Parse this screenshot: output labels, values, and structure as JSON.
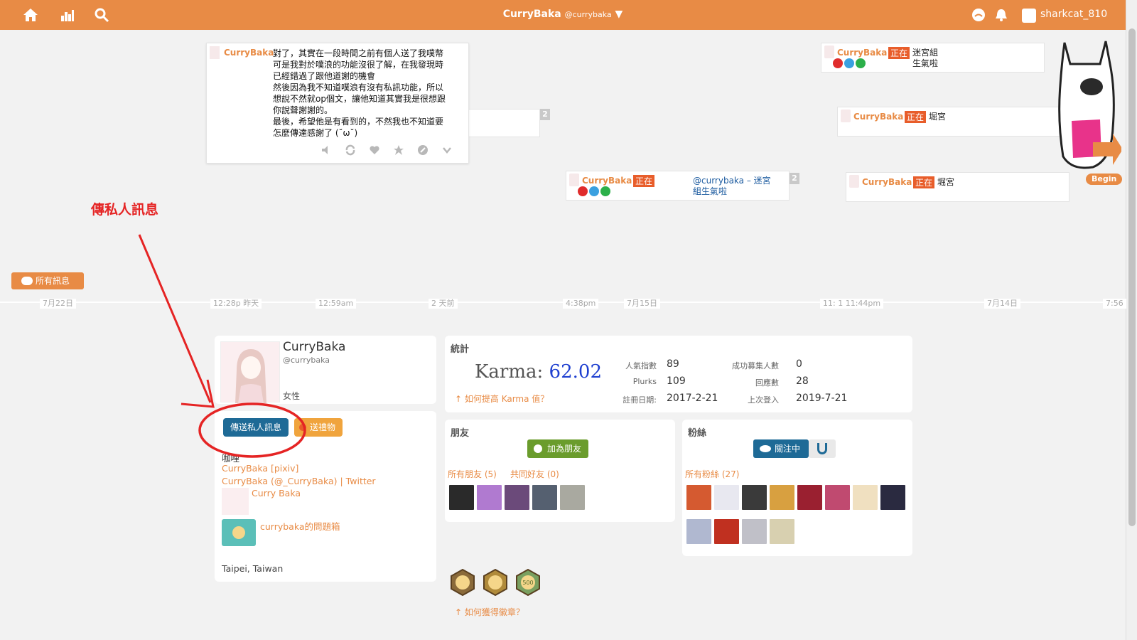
{
  "topbar": {
    "display_name": "CurryBaka",
    "handle": "@currybaka",
    "username": "sharkcat_810"
  },
  "colors": {
    "brand": "#e88b45",
    "link": "#e88b45",
    "karma": "#1e3fd0",
    "qualifier": "#e85d2a",
    "annotation": "#e52424"
  },
  "expanded_plurk": {
    "nick": "CurryBaka",
    "lines": [
      "對了，其實在一段時間之前有個人送了我噗幣",
      "可是我對於噗浪的功能沒很了解，在我發現時",
      "已經錯過了跟他道謝的機會",
      "然後因為我不知道噗浪有沒有私訊功能，所以",
      "想說不然就op個文，讓他知道其實我是很想跟",
      "你說聲謝謝的。",
      "最後，希望他是有看到的，不然我也不知道要",
      "怎麼傳達感謝了 (˘ω˘)"
    ],
    "hidden_count": "2"
  },
  "plurks": [
    {
      "nick": "CurryBaka",
      "qualifier": "正在",
      "text1": "迷宮組",
      "text2": "生氣啦"
    },
    {
      "nick": "CurryBaka",
      "qualifier": "正在",
      "text1": "堀宮"
    },
    {
      "nick": "CurryBaka",
      "qualifier": "正在",
      "text1": "@currybaka – 迷宮",
      "text2": "組生氣啦",
      "count": "2"
    },
    {
      "nick": "CurryBaka",
      "qualifier": "正在",
      "text1": "堀宮"
    }
  ],
  "timeline": {
    "all_messages": "所有訊息",
    "labels": [
      "7月22日",
      "12:28p 昨天",
      "12:59am",
      "2 天前",
      "4:38pm",
      "7月15日",
      "11: 1 11:44pm",
      "7月14日",
      "7:56"
    ],
    "begin": "Begin"
  },
  "annotation": {
    "label": "傳私人訊息"
  },
  "profile": {
    "name": "CurryBaka",
    "handle": "@currybaka",
    "gender": "女性",
    "send_pm": "傳送私人訊息",
    "send_gift": "送禮物",
    "about": [
      {
        "text": "咖哩",
        "link": false
      },
      {
        "text": "CurryBaka [pixiv]",
        "link": true
      },
      {
        "text": "CurryBaka (@_CurryBaka) | Twitter",
        "link": true
      }
    ],
    "link_cards": [
      "Curry Baka",
      "currybaka的問題箱"
    ],
    "location": "Taipei, Taiwan"
  },
  "stats": {
    "title": "統計",
    "karma_label": "Karma:",
    "karma_value": "62.02",
    "improve_karma": "如何提高 Karma 值？",
    "rows": [
      {
        "l1": "人氣指數",
        "v1": "89",
        "l2": "成功募集人數",
        "v2": "0"
      },
      {
        "l1": "Plurks",
        "v1": "109",
        "l2": "回應數",
        "v2": "28"
      },
      {
        "l1": "註冊日期:",
        "v1": "2017-2-21",
        "l2": "上次登入",
        "v2": "2019-7-21"
      }
    ]
  },
  "friends": {
    "title": "朋友",
    "add": "加為朋友",
    "all": "所有朋友 (5)",
    "mutual": "共同好友 (0)",
    "thumb_colors": [
      "#2a2a2a",
      "#b07ad0",
      "#6b4a7a",
      "#556070",
      "#a9a9a0"
    ]
  },
  "fans": {
    "title": "粉絲",
    "following": "關注中",
    "all": "所有粉絲 (27)",
    "thumb_colors": [
      "#d55a30",
      "#e8e8f0",
      "#3a3a3a",
      "#d8a040",
      "#9a2030",
      "#c04a70",
      "#f0e0c0",
      "#2a2a40",
      "#b0b8d0",
      "#c03020",
      "#c0c0c8",
      "#d8d0b0"
    ]
  },
  "badges": {
    "howto": "如何獲得徽章？",
    "items": [
      {
        "color": "#8a6a3a",
        "label": ""
      },
      {
        "color": "#b08a3a",
        "label": ""
      },
      {
        "color": "#7aa060",
        "label": "500"
      }
    ]
  }
}
